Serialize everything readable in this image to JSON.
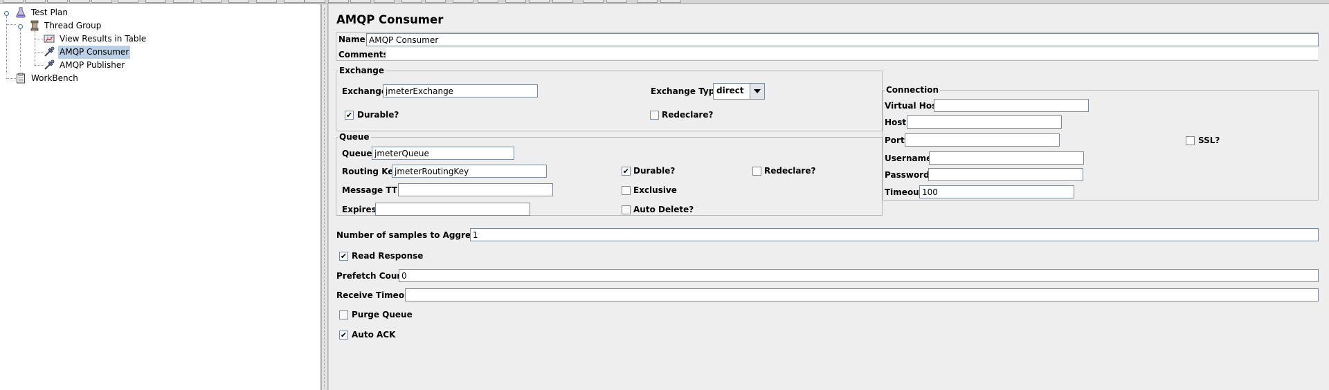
{
  "tree": {
    "items": [
      {
        "label": "Test Plan",
        "icon": "flask-icon"
      },
      {
        "label": "Thread Group",
        "icon": "spool-icon"
      },
      {
        "label": "View Results in Table",
        "icon": "table-icon"
      },
      {
        "label": "AMQP Consumer",
        "icon": "pipette-icon"
      },
      {
        "label": "AMQP Publisher",
        "icon": "pipette-icon"
      },
      {
        "label": "WorkBench",
        "icon": "clipboard-icon"
      }
    ]
  },
  "panel": {
    "title": "AMQP Consumer",
    "name_label": "Name:",
    "name_value": "AMQP Consumer",
    "comments_label": "Comments:",
    "comments_value": ""
  },
  "exchange": {
    "group_title": "Exchange",
    "exchange_label": "Exchange",
    "exchange_value": "jmeterExchange",
    "type_label": "Exchange Type",
    "type_value": "direct",
    "durable_label": "Durable?",
    "durable_checked": true,
    "redeclare_label": "Redeclare?",
    "redeclare_checked": false
  },
  "queue": {
    "group_title": "Queue",
    "queue_label": "Queue",
    "queue_value": "jmeterQueue",
    "routing_key_label": "Routing Key",
    "routing_key_value": "jmeterRoutingKey",
    "message_ttl_label": "Message TTL",
    "message_ttl_value": "",
    "expires_label": "Expires",
    "expires_value": "",
    "durable_label": "Durable?",
    "durable_checked": true,
    "redeclare_label": "Redeclare?",
    "redeclare_checked": false,
    "exclusive_label": "Exclusive",
    "exclusive_checked": false,
    "auto_delete_label": "Auto Delete?",
    "auto_delete_checked": false
  },
  "connection": {
    "group_title": "Connection",
    "virtual_host_label": "Virtual Host",
    "virtual_host_value": "",
    "host_label": "Host",
    "host_value": "",
    "port_label": "Port",
    "port_value": "",
    "ssl_label": "SSL?",
    "ssl_checked": false,
    "username_label": "Username",
    "username_value": "",
    "password_label": "Password",
    "password_value": "",
    "timeout_label": "Timeout",
    "timeout_value": "100"
  },
  "options": {
    "samples_label": "Number of samples to Aggregate",
    "samples_value": "1",
    "read_response_label": "Read Response",
    "read_response_checked": true,
    "prefetch_label": "Prefetch Count",
    "prefetch_value": "0",
    "receive_timeout_label": "Receive Timeout",
    "receive_timeout_value": "",
    "purge_queue_label": "Purge Queue",
    "purge_queue_checked": false,
    "auto_ack_label": "Auto ACK",
    "auto_ack_checked": true
  },
  "colors": {
    "selection": "#b8cfe5",
    "panel_bg": "#eeeeee",
    "tree_bg": "#ffffff"
  }
}
